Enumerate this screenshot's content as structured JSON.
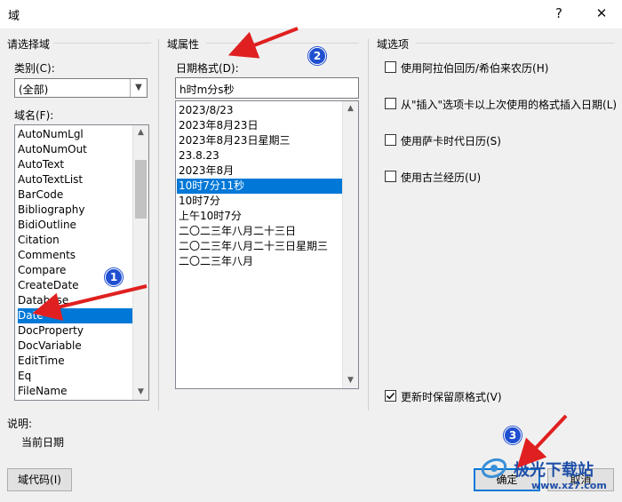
{
  "window": {
    "title": "域",
    "help_glyph": "?",
    "close_glyph": "✕"
  },
  "left_group": {
    "title": "请选择域",
    "category_label": "类别(C):",
    "category_value": "(全部)",
    "fieldname_label": "域名(F):",
    "fields": [
      "AutoNumLgl",
      "AutoNumOut",
      "AutoText",
      "AutoTextList",
      "BarCode",
      "Bibliography",
      "BidiOutline",
      "Citation",
      "Comments",
      "Compare",
      "CreateDate",
      "Database",
      "Date",
      "DocProperty",
      "DocVariable",
      "EditTime",
      "Eq",
      "FileName"
    ],
    "selected_field": "Date"
  },
  "middle_group": {
    "title": "域属性",
    "date_format_label": "日期格式(D):",
    "date_format_value": "h时m分s秒",
    "formats": [
      "2023/8/23",
      "2023年8月23日",
      "2023年8月23日星期三",
      "23.8.23",
      "2023年8月",
      "10时7分11秒",
      "10时7分",
      "上午10时7分",
      "二〇二三年八月二十三日",
      "二〇二三年八月二十三日星期三",
      "二〇二三年八月"
    ],
    "selected_format": "10时7分11秒"
  },
  "right_group": {
    "title": "域选项",
    "options": [
      {
        "label": "使用阿拉伯回历/希伯来农历(H)",
        "checked": false
      },
      {
        "label": "从\"插入\"选项卡以上次使用的格式插入日期(L)",
        "checked": false
      },
      {
        "label": "使用萨卡时代日历(S)",
        "checked": false
      },
      {
        "label": "使用古兰经历(U)",
        "checked": false
      }
    ],
    "preserve_format": {
      "label": "更新时保留原格式(V)",
      "checked": true
    }
  },
  "description": {
    "label": "说明:",
    "text": "当前日期"
  },
  "buttons": {
    "field_codes": "域代码(I)",
    "ok": "确定",
    "cancel": "取消"
  },
  "annotations": {
    "badge1": "1",
    "badge2": "2",
    "badge3": "3",
    "arrow_color": "#e02020",
    "badge_color": "#1f4fd1"
  },
  "watermark": {
    "text": "极光下载站",
    "url": "www.xz7.com"
  },
  "colors": {
    "selection": "#0078d7"
  }
}
